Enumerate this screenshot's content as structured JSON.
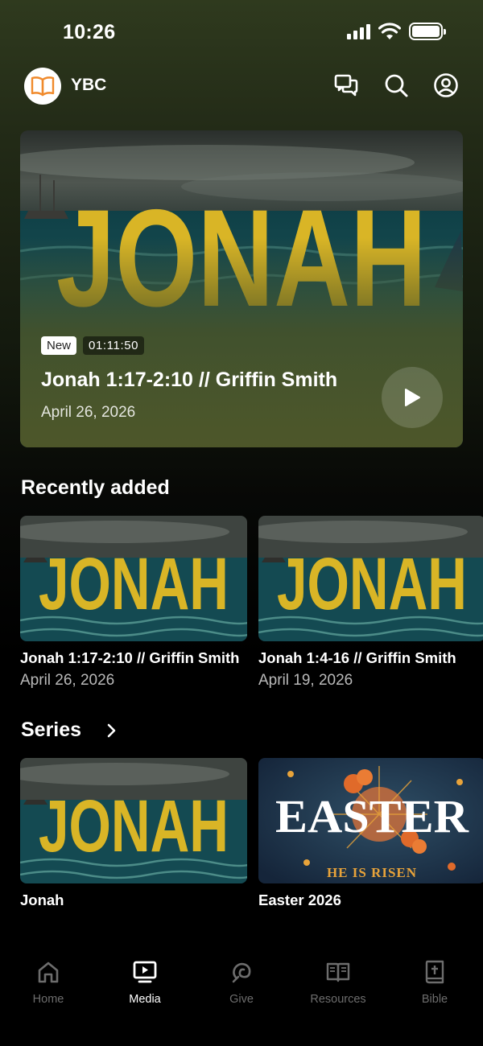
{
  "status_bar": {
    "time": "10:26"
  },
  "header": {
    "brand": "YBC"
  },
  "hero": {
    "badge_new": "New",
    "duration": "01:11:50",
    "title": "Jonah 1:17-2:10 // Griffin Smith",
    "date": "April 26, 2026",
    "art_text": "JONAH"
  },
  "recently_added": {
    "title": "Recently added",
    "items": [
      {
        "title": "Jonah 1:17-2:10 // Griffin Smith",
        "date": "April 26, 2026",
        "art_text": "JONAH"
      },
      {
        "title": "Jonah 1:4-16 // Griffin Smith",
        "date": "April 19, 2026",
        "art_text": "JONAH"
      }
    ]
  },
  "series": {
    "title": "Series",
    "items": [
      {
        "title": "Jonah",
        "art_text": "JONAH"
      },
      {
        "title": "Easter 2026",
        "art_text": "EASTER",
        "art_subtext": "HE IS RISEN"
      }
    ]
  },
  "tabbar": {
    "tabs": [
      {
        "label": "Home",
        "icon": "home-icon",
        "active": false
      },
      {
        "label": "Media",
        "icon": "media-icon",
        "active": true
      },
      {
        "label": "Give",
        "icon": "give-icon",
        "active": false
      },
      {
        "label": "Resources",
        "icon": "book-icon",
        "active": false
      },
      {
        "label": "Bible",
        "icon": "bible-icon",
        "active": false
      }
    ]
  },
  "colors": {
    "accent_orange": "#f08a2c",
    "jonah_yellow": "#d9b526",
    "sea_teal": "#1f5f66",
    "active_tab": "#ffffff",
    "inactive_tab": "#6d6d6d"
  }
}
